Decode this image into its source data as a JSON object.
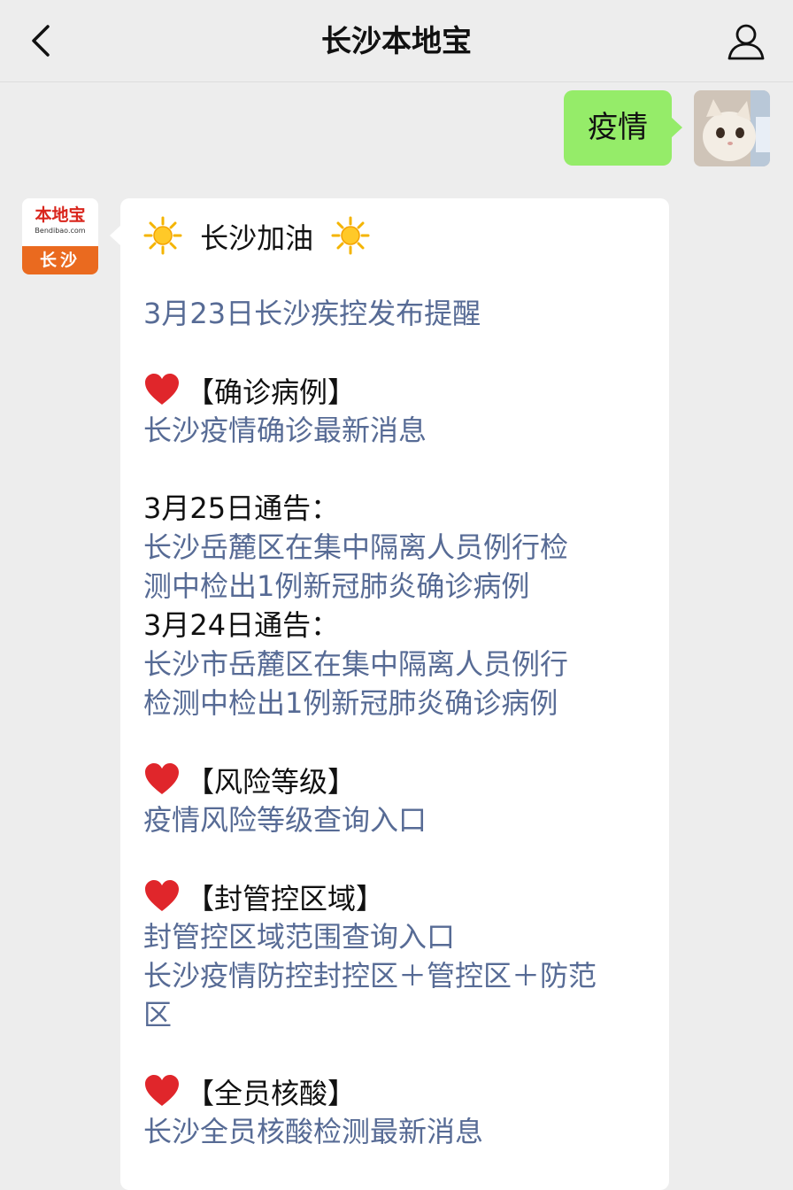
{
  "header": {
    "title": "长沙本地宝",
    "back_icon": "chevron-left-icon",
    "profile_icon": "person-icon"
  },
  "outgoing_message": {
    "text": "疫情",
    "bubble_color": "#95ec69"
  },
  "account_avatar": {
    "brand": "本地宝",
    "domain": "Bendibao.com",
    "city": "长沙"
  },
  "reply": {
    "title": "长沙加油",
    "link_color": "#576b95",
    "lines": {
      "reminder": "3月23日长沙疾控发布提醒",
      "section_confirmed": "【确诊病例】",
      "confirmed_link": "长沙疫情确诊最新消息",
      "notice_0325": "3月25日通告：",
      "notice_0325_link_1": "长沙岳麓区在集中隔离人员例行检",
      "notice_0325_link_2": "测中检出1例新冠肺炎确诊病例",
      "notice_0324": "3月24日通告：",
      "notice_0324_link_1": "长沙市岳麓区在集中隔离人员例行",
      "notice_0324_link_2": "检测中检出1例新冠肺炎确诊病例",
      "section_risk": "【风险等级】",
      "risk_link": "疫情风险等级查询入口",
      "section_control": "【封管控区域】",
      "control_link_1": "封管控区域范围查询入口",
      "control_link_2": "长沙疫情防控封控区＋管控区＋防范",
      "control_link_3": "区",
      "section_test": "【全员核酸】",
      "test_link": "长沙全员核酸检测最新消息"
    }
  }
}
